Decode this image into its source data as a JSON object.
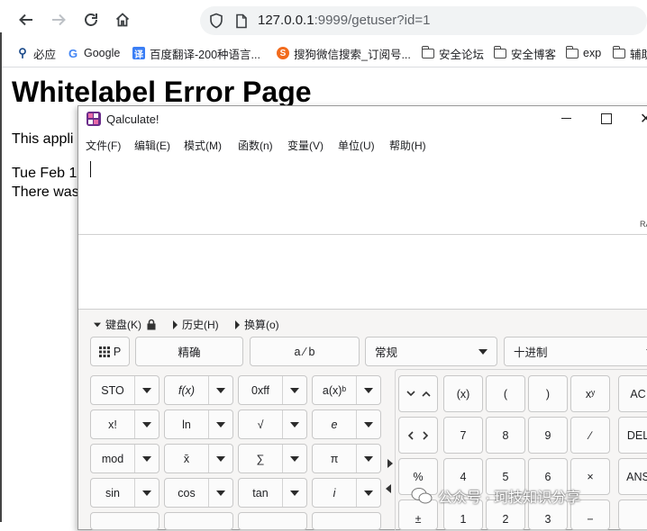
{
  "browser": {
    "url_host": "127.0.0.1",
    "url_rest": ":9999/getuser?id=1",
    "bookmarks": [
      {
        "label": "必应",
        "icon": "search-icon"
      },
      {
        "label": "Google",
        "icon": "google-icon"
      },
      {
        "label": "百度翻译-200种语言...",
        "icon": "translate-icon"
      },
      {
        "label": "搜狗微信搜索_订阅号...",
        "icon": "sogou-icon"
      },
      {
        "label": "安全论坛",
        "icon": "folder-icon"
      },
      {
        "label": "安全博客",
        "icon": "folder-icon"
      },
      {
        "label": "exp",
        "icon": "folder-icon"
      },
      {
        "label": "辅助",
        "icon": "folder-icon"
      }
    ]
  },
  "page": {
    "title": "Whitelabel Error Page",
    "line1": "This appli",
    "line2": "Tue Feb 1",
    "line3": "There was"
  },
  "qalculate": {
    "title": "Qalculate!",
    "menu": [
      "文件(F)",
      "编辑(E)",
      "模式(M)",
      "函数(n)",
      "变量(V)",
      "单位(U)",
      "帮助(H)"
    ],
    "status_mode": "RA",
    "toggles": {
      "keypad": "键盘(K)",
      "history": "历史(H)",
      "convert": "换算(o)"
    },
    "toolbar": {
      "p_label": "P",
      "exact": "精确",
      "fraction": "a ⁄ b",
      "display_mode": "常规",
      "base": "十进制"
    },
    "keys_left": [
      [
        "STO",
        "f(x)",
        "0xff",
        "a(x)ᵇ"
      ],
      [
        "x!",
        "ln",
        "√",
        "e"
      ],
      [
        "mod",
        "x̄",
        "∑",
        "π"
      ],
      [
        "sin",
        "cos",
        "tan",
        "i"
      ]
    ],
    "keys_right": [
      [
        "(x)",
        "(",
        ")",
        "xʸ",
        "AC"
      ],
      [
        "7",
        "8",
        "9",
        "∕",
        "DEL"
      ],
      [
        "4",
        "5",
        "6",
        "×",
        "ANS"
      ],
      [
        "1",
        "2",
        "3",
        "−",
        ""
      ]
    ],
    "keys_nav": [
      "%",
      "±"
    ]
  },
  "watermark": "公众号 · 珂技知识分享"
}
